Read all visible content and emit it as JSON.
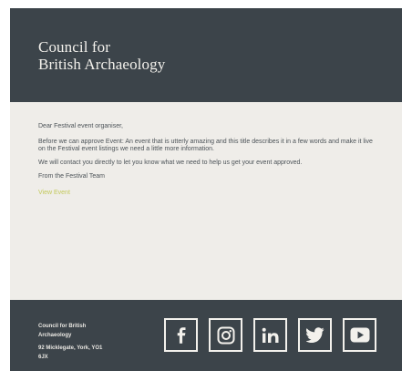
{
  "header": {
    "brand_line1": "Council for",
    "brand_line2": "British Archaeology"
  },
  "body": {
    "greeting": "Dear Festival event organiser,",
    "paragraph1": "Before we can approve Event: An event that is utterly amazing and this title describes it in a few words and make it live on the Festival event listings we need a little more information.",
    "paragraph2": "We will contact you directly to let you know what we need to help us get your event approved.",
    "signoff": "From the Festival Team",
    "link_text": "View Event"
  },
  "footer": {
    "org_line1": "Council for British",
    "org_line2": "Archaeology",
    "address_line1": "92 Micklegate, York, YO1",
    "address_line2": "6JX",
    "social_icons": [
      "facebook-icon",
      "instagram-icon",
      "linkedin-icon",
      "twitter-icon",
      "youtube-icon"
    ]
  },
  "colors": {
    "header_bg": "#3c444a",
    "body_bg": "#efede9",
    "link": "#c3c95a",
    "text": "#4c5358"
  }
}
